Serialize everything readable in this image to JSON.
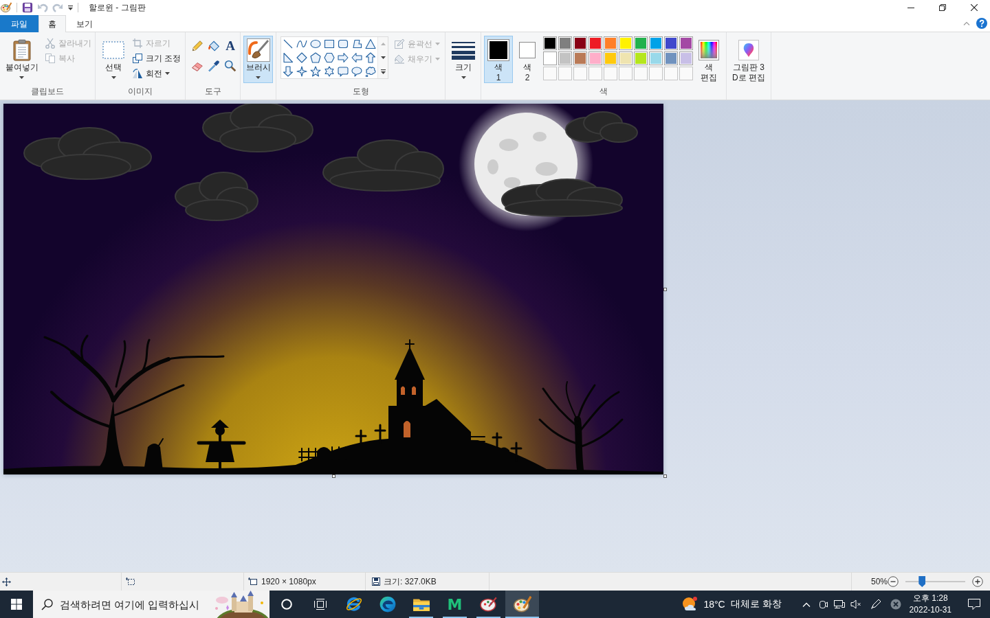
{
  "window": {
    "title": "할로윈 - 그림판",
    "quick_access": [
      {
        "kind": "save",
        "disabled": false
      },
      {
        "kind": "undo",
        "disabled": true
      },
      {
        "kind": "redo",
        "disabled": true
      }
    ]
  },
  "tabs": [
    {
      "label": "파일",
      "kind": "file",
      "selected": false
    },
    {
      "label": "홈",
      "kind": "tab",
      "selected": true
    },
    {
      "label": "보기",
      "kind": "tab",
      "selected": false
    }
  ],
  "ribbon": {
    "clipboard": {
      "label": "클립보드",
      "paste": "붙여넣기",
      "cut": {
        "label": "잘라내기",
        "disabled": true
      },
      "copy": {
        "label": "복사",
        "disabled": true
      }
    },
    "image": {
      "label": "이미지",
      "select": "선택",
      "crop": {
        "label": "자르기",
        "disabled": true
      },
      "resize": {
        "label": "크기 조정",
        "disabled": false
      },
      "rotate": {
        "label": "회전",
        "disabled": false
      }
    },
    "tools": {
      "label": "도구",
      "items": [
        {
          "kind": "pencil"
        },
        {
          "kind": "fill"
        },
        {
          "kind": "text",
          "glyph": "A"
        },
        {
          "kind": "eraser"
        },
        {
          "kind": "picker"
        },
        {
          "kind": "magnifier"
        }
      ]
    },
    "brushes": {
      "label": "브러시",
      "selected": true
    },
    "shapes": {
      "label": "도형",
      "items": [
        {
          "kind": "line"
        },
        {
          "kind": "curve"
        },
        {
          "kind": "oval"
        },
        {
          "kind": "rectangle"
        },
        {
          "kind": "rounded-rectangle"
        },
        {
          "kind": "polygon"
        },
        {
          "kind": "triangle"
        },
        {
          "kind": "right-triangle"
        },
        {
          "kind": "diamond"
        },
        {
          "kind": "pentagon"
        },
        {
          "kind": "hexagon"
        },
        {
          "kind": "right-arrow"
        },
        {
          "kind": "left-arrow"
        },
        {
          "kind": "up-arrow"
        },
        {
          "kind": "down-arrow"
        },
        {
          "kind": "four-point-star"
        },
        {
          "kind": "five-point-star"
        },
        {
          "kind": "six-point-star"
        },
        {
          "kind": "rounded-callout"
        },
        {
          "kind": "oval-callout"
        },
        {
          "kind": "cloud-callout"
        }
      ],
      "outline": {
        "label": "윤곽선",
        "disabled": true
      },
      "fill": {
        "label": "채우기",
        "disabled": true
      }
    },
    "size": {
      "label": "크기"
    },
    "colors": {
      "label": "색",
      "color1": {
        "lines": [
          "색",
          "1"
        ],
        "color": "#000000",
        "selected": true
      },
      "color2": {
        "lines": [
          "색",
          "2"
        ],
        "color": "#ffffff",
        "selected": false
      },
      "palette": [
        {
          "color": "#000000"
        },
        {
          "color": "#7f7f7f"
        },
        {
          "color": "#880015"
        },
        {
          "color": "#ed1c24"
        },
        {
          "color": "#ff7f27"
        },
        {
          "color": "#fff200"
        },
        {
          "color": "#22b14c"
        },
        {
          "color": "#00a2e8"
        },
        {
          "color": "#3f48cc"
        },
        {
          "color": "#a349a4"
        },
        {
          "color": "#ffffff"
        },
        {
          "color": "#c3c3c3"
        },
        {
          "color": "#b97a57"
        },
        {
          "color": "#ffaec9"
        },
        {
          "color": "#ffc90e"
        },
        {
          "color": "#efe4b0"
        },
        {
          "color": "#b5e61d"
        },
        {
          "color": "#99d9ea"
        },
        {
          "color": "#7092be"
        },
        {
          "color": "#c8bfe7"
        }
      ],
      "edit": {
        "lines": [
          "색",
          "편집"
        ]
      }
    },
    "paint3d": {
      "lines": [
        "그림판 3",
        "D로 편집"
      ]
    }
  },
  "status_bar": {
    "dimensions": "1920 × 1080px",
    "file_size": "크기: 327.0KB",
    "zoom": {
      "label": "50%",
      "level": 0.25
    }
  },
  "taskbar": {
    "search": {
      "placeholder": "검색하려면 여기에 입력하십시"
    },
    "apps": [
      {
        "kind": "ie",
        "running": false,
        "selected": false
      },
      {
        "kind": "edge",
        "running": false,
        "selected": false
      },
      {
        "kind": "explorer",
        "running": true,
        "selected": false
      },
      {
        "kind": "letter",
        "glyph": "M",
        "running": true,
        "selected": false
      },
      {
        "kind": "brush-app",
        "running": true,
        "selected": false
      },
      {
        "kind": "paint",
        "running": true,
        "selected": true
      }
    ],
    "weather": {
      "temperature": "18°C",
      "condition": "대체로 화창"
    },
    "clock": {
      "time": "오후 1:28",
      "date": "2022-10-31"
    }
  }
}
